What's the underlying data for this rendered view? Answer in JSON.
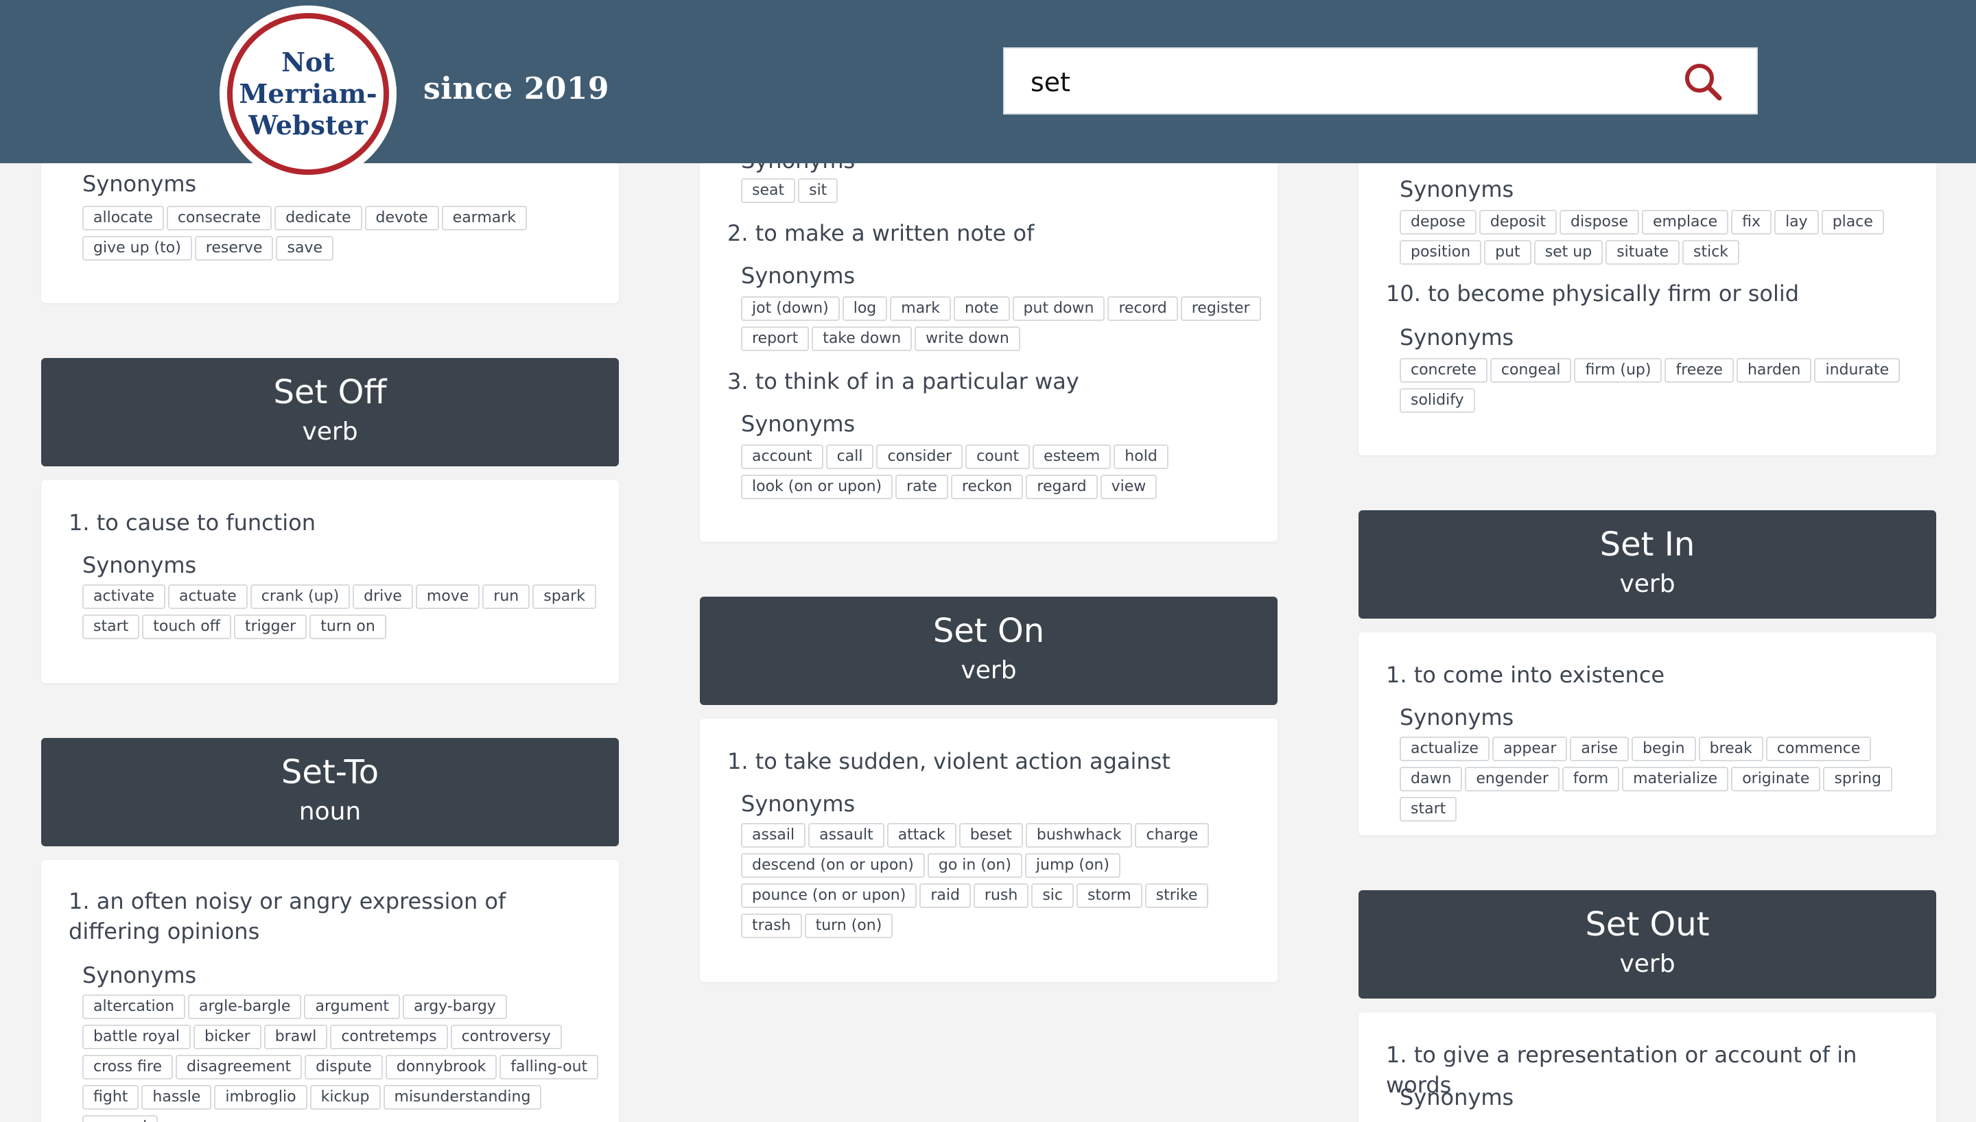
{
  "header": {
    "logo_text": "Not Merriam-Webster",
    "tagline": "since 2019",
    "search": {
      "value": "set",
      "placeholder": ""
    }
  },
  "columns": {
    "c1": {
      "top_card": {
        "syn_label": "Synonyms",
        "synonyms": [
          "allocate",
          "consecrate",
          "dedicate",
          "devote",
          "earmark",
          "give up (to)",
          "reserve",
          "save"
        ]
      },
      "entry_1": {
        "title": "Set Off",
        "pos": "verb",
        "senses": [
          {
            "definition": "1. to cause to function",
            "syn_label": "Synonyms",
            "synonyms": [
              "activate",
              "actuate",
              "crank (up)",
              "drive",
              "move",
              "run",
              "spark",
              "start",
              "touch off",
              "trigger",
              "turn on"
            ]
          }
        ]
      },
      "entry_2": {
        "title": "Set-To",
        "pos": "noun",
        "senses": [
          {
            "definition": "1. an often noisy or angry expression of differing opinions",
            "syn_label": "Synonyms",
            "synonyms": [
              "altercation",
              "argle-bargle",
              "argument",
              "argy-bargy",
              "battle royal",
              "bicker",
              "brawl",
              "contretemps",
              "controversy",
              "cross fire",
              "disagreement",
              "dispute",
              "donnybrook",
              "falling-out",
              "fight",
              "hassle",
              "imbroglio",
              "kickup",
              "misunderstanding",
              "quarrel"
            ]
          }
        ]
      }
    },
    "c2": {
      "top_card": {
        "syn_label": "Synonyms",
        "synonyms": [
          "seat",
          "sit"
        ],
        "senses": [
          {
            "definition": "2. to make a written note of",
            "syn_label": "Synonyms",
            "synonyms": [
              "jot (down)",
              "log",
              "mark",
              "note",
              "put down",
              "record",
              "register",
              "report",
              "take down",
              "write down"
            ]
          },
          {
            "definition": "3. to think of in a particular way",
            "syn_label": "Synonyms",
            "synonyms": [
              "account",
              "call",
              "consider",
              "count",
              "esteem",
              "hold",
              "look (on or upon)",
              "rate",
              "reckon",
              "regard",
              "view"
            ]
          }
        ]
      },
      "entry_1": {
        "title": "Set On",
        "pos": "verb",
        "senses": [
          {
            "definition": "1. to take sudden, violent action against",
            "syn_label": "Synonyms",
            "synonyms": [
              "assail",
              "assault",
              "attack",
              "beset",
              "bushwhack",
              "charge",
              "descend (on or upon)",
              "go in (on)",
              "jump (on)",
              "pounce (on or upon)",
              "raid",
              "rush",
              "sic",
              "storm",
              "strike",
              "trash",
              "turn (on)"
            ]
          }
        ]
      }
    },
    "c3": {
      "top_card": {
        "syn_label": "Synonyms",
        "synonyms": [
          "depose",
          "deposit",
          "dispose",
          "emplace",
          "fix",
          "lay",
          "place",
          "position",
          "put",
          "set up",
          "situate",
          "stick"
        ],
        "senses": [
          {
            "definition": "10. to become physically firm or solid",
            "syn_label": "Synonyms",
            "synonyms": [
              "concrete",
              "congeal",
              "firm (up)",
              "freeze",
              "harden",
              "indurate",
              "solidify"
            ]
          }
        ]
      },
      "entry_1": {
        "title": "Set In",
        "pos": "verb",
        "senses": [
          {
            "definition": "1. to come into existence",
            "syn_label": "Synonyms",
            "synonyms": [
              "actualize",
              "appear",
              "arise",
              "begin",
              "break",
              "commence",
              "dawn",
              "engender",
              "form",
              "materialize",
              "originate",
              "spring",
              "start"
            ]
          }
        ]
      },
      "entry_2": {
        "title": "Set Out",
        "pos": "verb",
        "senses": [
          {
            "definition": "1. to give a representation or account of in words",
            "syn_label": "Synonyms",
            "synonyms": []
          }
        ]
      }
    }
  }
}
